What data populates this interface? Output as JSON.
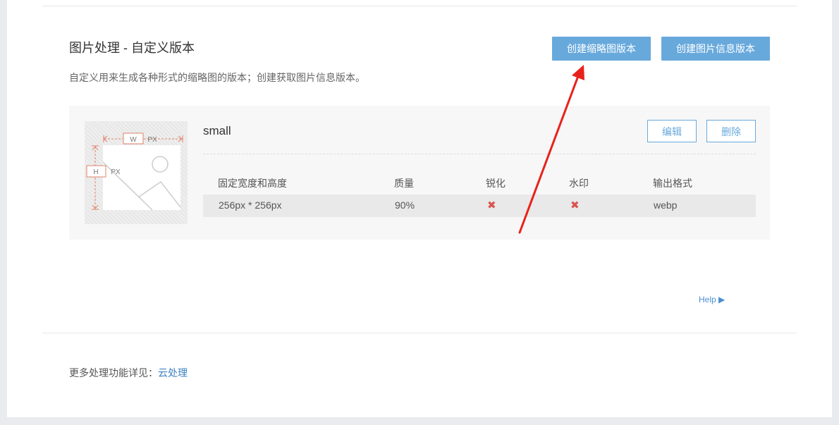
{
  "section": {
    "title": "图片处理 - 自定义版本",
    "description": "自定义用来生成各种形式的缩略图的版本；创建获取图片信息版本。",
    "create_thumbnail_label": "创建缩略图版本",
    "create_info_label": "创建图片信息版本"
  },
  "version": {
    "name": "small",
    "edit_label": "编辑",
    "delete_label": "删除",
    "thumb": {
      "w_label": "W",
      "h_label": "H",
      "px_label": "PX"
    },
    "table": {
      "headers": [
        "固定宽度和高度",
        "质量",
        "锐化",
        "水印",
        "输出格式"
      ],
      "row": {
        "size": "256px * 256px",
        "quality": "90%",
        "sharpen": "✖",
        "watermark": "✖",
        "format": "webp"
      }
    }
  },
  "help": {
    "label": "Help ▶"
  },
  "footer": {
    "prefix": "更多处理功能详见：",
    "link": "云处理"
  },
  "colors": {
    "accent": "#68a9dc",
    "link": "#3d82c4",
    "error": "#d9534f",
    "annotation": "#e8221b"
  }
}
